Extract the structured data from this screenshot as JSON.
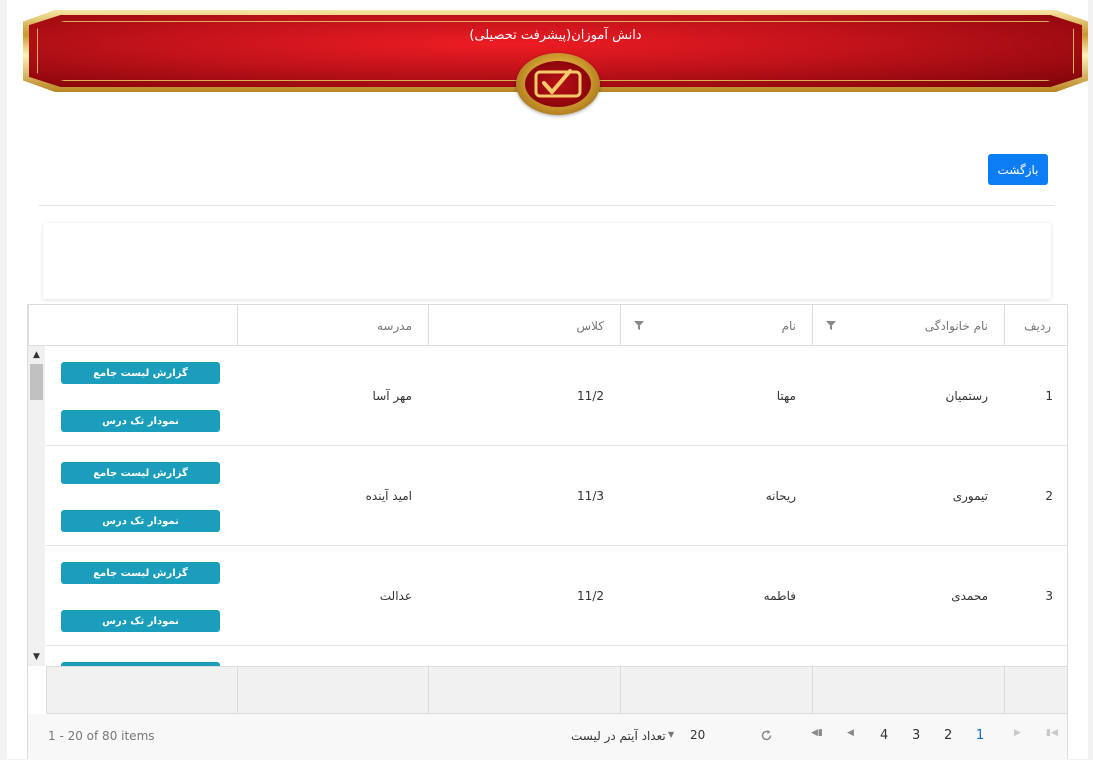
{
  "banner": {
    "title": "دانش آموزان(پیشرفت تحصیلی)"
  },
  "toolbar": {
    "back_label": "بازگشت"
  },
  "grid": {
    "columns": [
      "ردیف",
      "نام خانوادگی",
      "نام",
      "کلاس",
      "مدرسه"
    ],
    "rows": [
      {
        "index": "1",
        "last_name": "رستمیان",
        "first_name": "مهتا",
        "class": "11/2",
        "school": "مهر آسا"
      },
      {
        "index": "2",
        "last_name": "تیموری",
        "first_name": "ریحانه",
        "class": "11/3",
        "school": "امید آینده"
      },
      {
        "index": "3",
        "last_name": "محمدی",
        "first_name": "فاطمه",
        "class": "11/2",
        "school": "عدالت"
      }
    ],
    "actions": {
      "report": "گزارش لیست جامع",
      "chart": "نمودار تک درس"
    }
  },
  "pager": {
    "pages": [
      "1",
      "2",
      "3",
      "4"
    ],
    "active_page": "1",
    "page_size": "20",
    "page_size_label": "تعداد آیتم در لیست",
    "info": "1 - 20 of 80 items"
  },
  "colors": {
    "banner_red": "#c0121a",
    "gold": "#d6a233",
    "primary": "#0d7df5",
    "action": "#1a9ebc"
  },
  "icons": [
    "filter-icon",
    "refresh-icon",
    "first-page-icon",
    "prev-page-icon",
    "next-page-icon",
    "last-page-icon",
    "dropdown-arrow-icon",
    "checkmark-logo-icon"
  ]
}
